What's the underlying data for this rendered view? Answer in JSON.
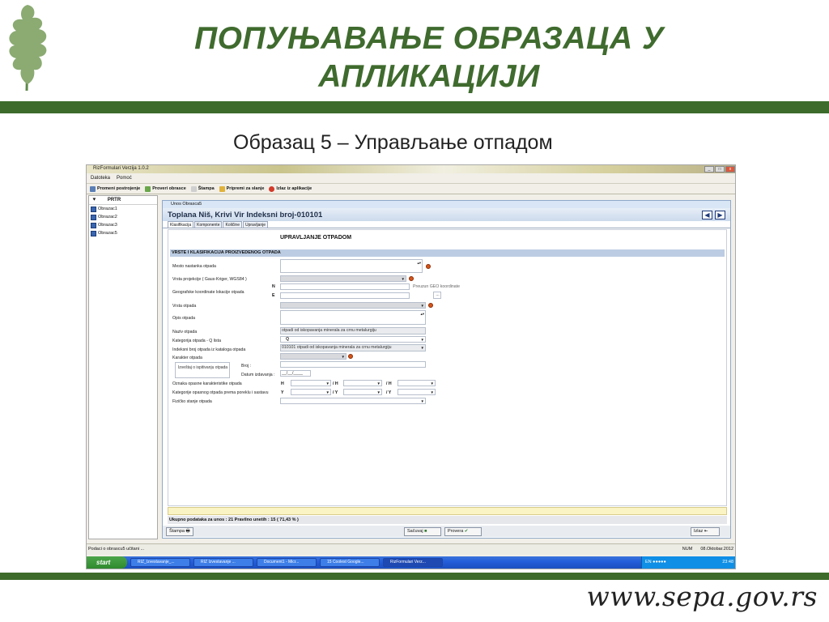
{
  "slide": {
    "title_line1": "ПОПУЊАВАЊЕ ОБРАЗАЦА У",
    "title_line2": "АПЛИКАЦИЈИ",
    "subtitle": "Образац 5 – Управљање отпадом",
    "url": "www.sepa.gov.rs",
    "brand_green": "#3d6b2b"
  },
  "app": {
    "window_title": "RizFormulari Verzija 1.0.2",
    "menu": [
      "Datoteka",
      "Pomoć"
    ],
    "toolbar": [
      {
        "label": "Promeni postrojenje",
        "icon": "building-icon"
      },
      {
        "label": "Proveri obrasce",
        "icon": "check-icon"
      },
      {
        "label": "Štampa",
        "icon": "printer-icon"
      },
      {
        "label": "Pripremi za slanje",
        "icon": "send-icon"
      },
      {
        "label": "Izlaz iz aplikacije",
        "icon": "exit-icon"
      }
    ],
    "tree": {
      "header": "PRTR",
      "items": [
        "Obrazac1",
        "Obrazac2",
        "Obrazac3",
        "Obrazac5"
      ]
    },
    "form": {
      "caption": "Unos Obrasca5",
      "header_title": "Toplana Niš, Krivi Vir   Indeksni broj-010101",
      "tabs": [
        "Klasifikacija",
        "Komponente",
        "Količine",
        "Upravljanje"
      ],
      "heading": "UPRAVLJANJE OTPADOM",
      "section": "VRSTE I KLASIFIKACIJA PROIZVEDENOG OTPADA",
      "labels": {
        "mesto": "Mesto nastanka otpada",
        "projekcija": "Vrsta projekcije ( Gaus-Kriger, WGS84 )",
        "koordinate": "Geografske koordinate lokacije otpada",
        "n": "N",
        "e": "E",
        "geo_link": "Preuzun GEO koordinate",
        "geo_btn": "...",
        "vrsta": "Vrsta otpada",
        "opis": "Opis otpada",
        "naziv": "Naziv otpada",
        "kategorija": "Kategorija otpada - Q lista",
        "indeksni": "Indeksni broj otpada iz kataloga otpada",
        "karakter": "Karakter otpada",
        "izvestaj_btn": "Izveštaj o ispitivanju otpada",
        "broj": "Broj :",
        "datum": "Datum izdavanja :",
        "oznaka_h": "Oznaka opasne karakteristike otpada",
        "kategorije_y": "Kategorije opasnog otpada prema poreklu i sastavu",
        "fizicko": "Fizičko stanje otpada",
        "h": "H",
        "y": "Y",
        "slash_h": "/ H",
        "slash_y": "/ Y"
      },
      "values": {
        "naziv": "otpadi od iskopavanja minerala za crnu metalurgiju",
        "kategorija": "Q",
        "indeksni": "010101 otpadi od iskopavanja minerala za crnu metalurgiju",
        "datum": "__/__/____"
      },
      "summary": "Ukupno podataka za unos : 21  Pravilno unetih : 15  ( 71,43 % )",
      "buttons": {
        "print": "Štampa",
        "save": "Sačuvaj",
        "check": "Provera",
        "exit": "Izlaz"
      }
    },
    "status": {
      "left": "Podaci o obrascu5 učitani ...",
      "num": "NUM",
      "date": "08.Oktobar.2012"
    },
    "taskbar": {
      "start": "start",
      "tasks": [
        "RIZ_Izvestavanje_...",
        "RIZ Izvestavanje ...",
        "Document1 - Micr...",
        "15 Coolest Google...",
        "RizFormulari Verz..."
      ],
      "lang": "EN",
      "time": "23:48"
    }
  }
}
